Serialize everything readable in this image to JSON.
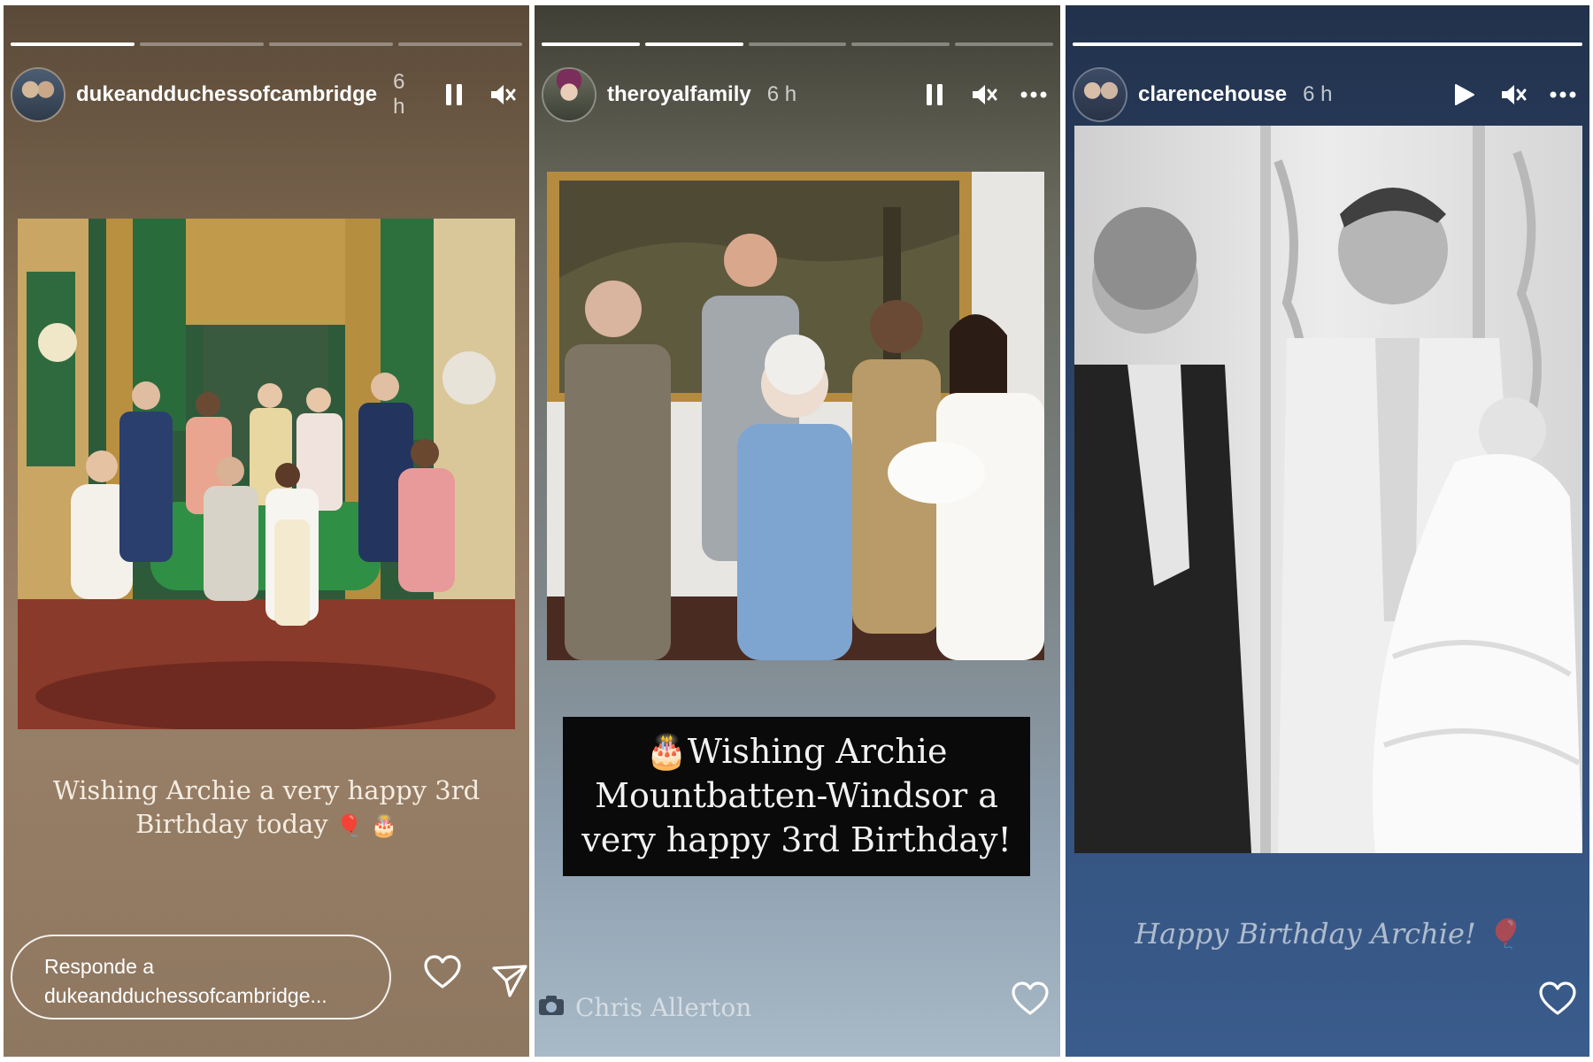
{
  "stories": [
    {
      "username": "dukeandduchessofcambridge",
      "time": "6 h",
      "caption_line1": "Wishing Archie a very happy 3rd",
      "caption_line2": "Birthday today",
      "caption_emoji_balloon": "🎈",
      "caption_emoji_cake": "🎂",
      "reply_line1": "Responde a",
      "reply_line2": "dukeandduchessofcambridge...",
      "progress": [
        1.0,
        0.0,
        0.0,
        0.0
      ],
      "controls": [
        "pause-icon",
        "mute-icon"
      ],
      "actions": [
        "heart-icon",
        "send-icon"
      ]
    },
    {
      "username": "theroyalfamily",
      "time": "6 h",
      "caption_line1": "🎂Wishing Archie",
      "caption_line2": "Mountbatten-Windsor a",
      "caption_line3": "very happy 3rd Birthday!",
      "credit": "Chris Allerton",
      "progress": [
        1.0,
        1.0,
        0.0,
        0.0,
        0.0
      ],
      "controls": [
        "pause-icon",
        "mute-icon",
        "more-icon"
      ],
      "actions": [
        "heart-icon"
      ]
    },
    {
      "username": "clarencehouse",
      "time": "6 h",
      "caption": "Happy Birthday Archie! 🎈",
      "progress": [
        1.0
      ],
      "controls": [
        "play-icon",
        "mute-icon",
        "more-icon"
      ],
      "actions": [
        "heart-icon"
      ]
    }
  ],
  "colors": {
    "panel1_bg": "#8a7259",
    "panel2_bg": "#7d8588",
    "panel3_bg": "#2e4a73",
    "caption_box": "#0a0a0a"
  }
}
